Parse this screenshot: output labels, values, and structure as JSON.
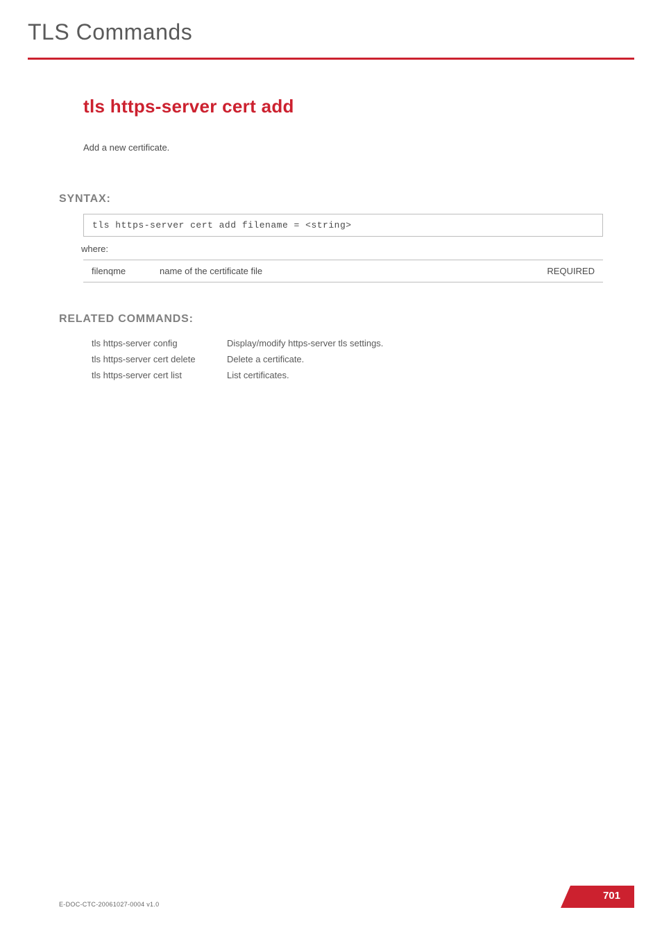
{
  "header": {
    "chapter_title": "TLS Commands"
  },
  "command": {
    "title": "tls https-server cert add",
    "description": "Add a new certificate."
  },
  "syntax": {
    "heading": "SYNTAX:",
    "command_text": "tls https-server cert add  filename = <string>",
    "where_label": "where:",
    "params": [
      {
        "name": "filenqme",
        "desc": "name of the certificate file",
        "req": "REQUIRED"
      }
    ]
  },
  "related": {
    "heading": "RELATED COMMANDS:",
    "items": [
      {
        "cmd": "tls https-server config",
        "desc": "Display/modify https-server tls settings."
      },
      {
        "cmd": "tls https-server cert delete",
        "desc": "Delete a certificate."
      },
      {
        "cmd": "tls https-server cert list",
        "desc": "List certificates."
      }
    ]
  },
  "footer": {
    "doc_id": "E-DOC-CTC-20061027-0004 v1.0",
    "page_number": "701"
  }
}
